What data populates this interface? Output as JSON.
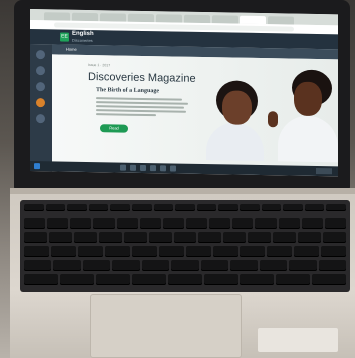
{
  "app": {
    "logo": "EE",
    "brand": "English",
    "brand_sub": "Discoveries",
    "subnav_item": "Home"
  },
  "article": {
    "crumb": "Issue 1 · 2017",
    "headline": "Discoveries Magazine",
    "subhead": "The Birth of a Language",
    "read_label": "Read"
  },
  "colors": {
    "header": "#24323f",
    "accent": "#1e9a54"
  }
}
